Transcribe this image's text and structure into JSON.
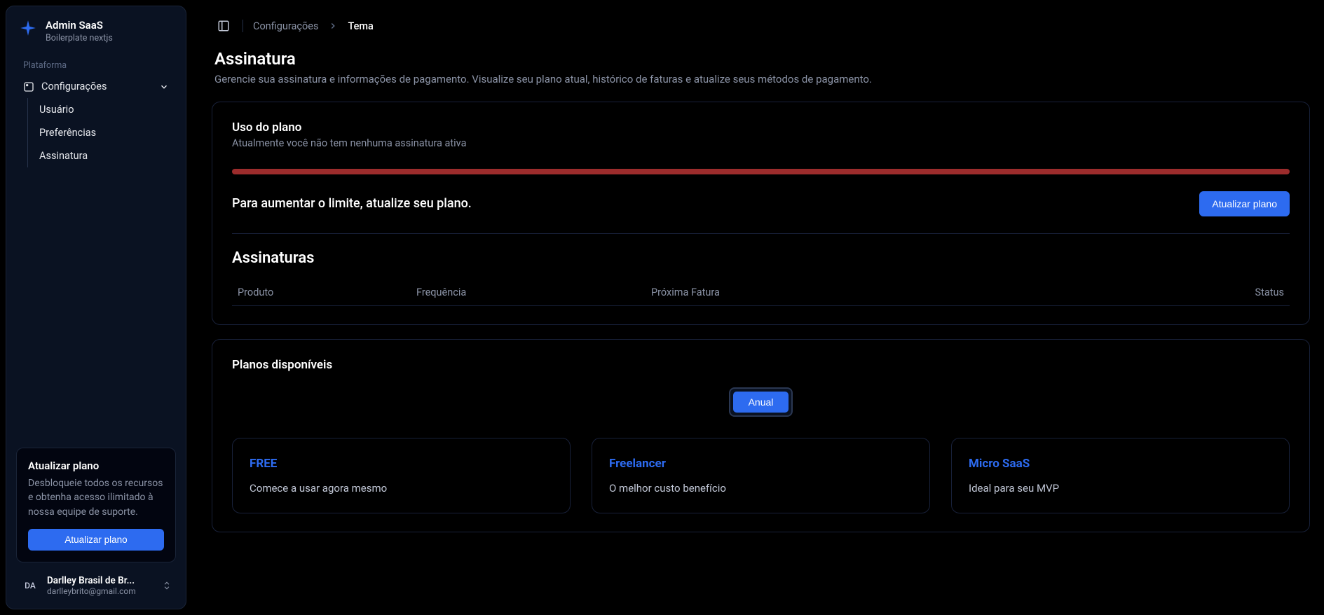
{
  "brand": {
    "title": "Admin SaaS",
    "subtitle": "Boilerplate nextjs"
  },
  "sidebar": {
    "section_label": "Plataforma",
    "config_label": "Configurações",
    "items": [
      {
        "label": "Usuário"
      },
      {
        "label": "Preferências"
      },
      {
        "label": "Assinatura"
      }
    ],
    "upgrade": {
      "title": "Atualizar plano",
      "text": "Desbloqueie todos os recursos e obtenha acesso ilimitado à nossa equipe de suporte.",
      "button": "Atualizar plano"
    },
    "user": {
      "initials": "DA",
      "name": "Darlley Brasil de Br...",
      "email": "darlleybrito@gmail.com"
    }
  },
  "breadcrumb": {
    "parent": "Configurações",
    "current": "Tema"
  },
  "page": {
    "title": "Assinatura",
    "description": "Gerencie sua assinatura e informações de pagamento. Visualize seu plano atual, histórico de faturas e atualize seus métodos de pagamento."
  },
  "usage": {
    "title": "Uso do plano",
    "subtitle": "Atualmente você não tem nenhuma assinatura ativa",
    "limit_text": "Para aumentar o limite, atualize seu plano.",
    "upgrade_button": "Atualizar plano"
  },
  "subs": {
    "heading": "Assinaturas",
    "columns": {
      "product": "Produto",
      "frequency": "Frequência",
      "next_invoice": "Próxima Fatura",
      "status": "Status"
    }
  },
  "plans": {
    "title": "Planos disponíveis",
    "toggle": {
      "annual": "Anual"
    },
    "list": [
      {
        "name": "FREE",
        "tagline": "Comece a usar agora mesmo"
      },
      {
        "name": "Freelancer",
        "tagline": "O melhor custo benefício"
      },
      {
        "name": "Micro SaaS",
        "tagline": "Ideal para seu MVP"
      }
    ]
  }
}
